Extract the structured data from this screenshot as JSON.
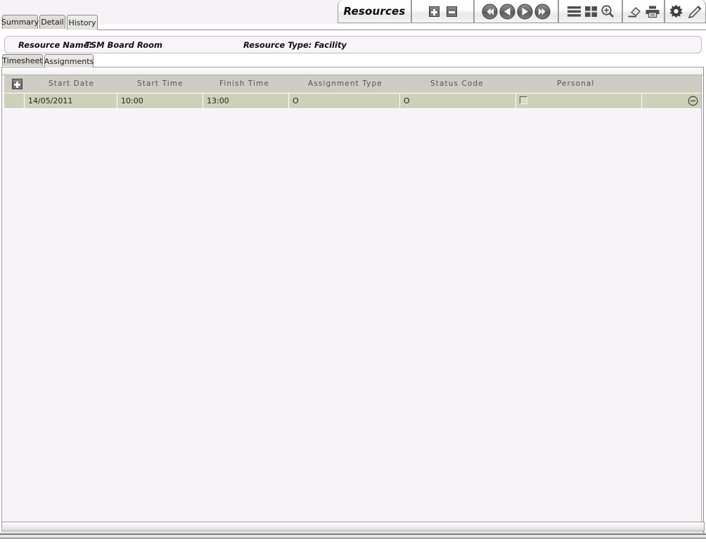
{
  "toolbar": {
    "title": "Resources",
    "groups": [
      {
        "name": "title-group",
        "items": [
          {
            "icon": "resources-label",
            "label": "Resources"
          }
        ]
      },
      {
        "name": "addremove-group",
        "items": [
          {
            "icon": "plus-square-icon",
            "label": "Add"
          },
          {
            "icon": "minus-square-icon",
            "label": "Remove"
          }
        ]
      },
      {
        "name": "navigation-group",
        "items": [
          {
            "icon": "first-record-icon",
            "label": "First"
          },
          {
            "icon": "previous-record-icon",
            "label": "Previous"
          },
          {
            "icon": "next-record-icon",
            "label": "Next"
          },
          {
            "icon": "last-record-icon",
            "label": "Last"
          }
        ]
      },
      {
        "name": "view-group",
        "items": [
          {
            "icon": "list-view-icon",
            "label": "List View"
          },
          {
            "icon": "grid-view-icon",
            "label": "Grid View"
          },
          {
            "icon": "zoom-search-icon",
            "label": "Find"
          }
        ]
      },
      {
        "name": "tools-group",
        "items": [
          {
            "icon": "eraser-icon",
            "label": "Clear"
          },
          {
            "icon": "printer-icon",
            "label": "Print"
          }
        ]
      },
      {
        "name": "edit-group",
        "items": [
          {
            "icon": "gear-icon",
            "label": "Settings"
          },
          {
            "icon": "pencil-icon",
            "label": "Edit"
          }
        ]
      }
    ]
  },
  "main_tabs": [
    {
      "label": "Summary",
      "active": false
    },
    {
      "label": "Detail",
      "active": false
    },
    {
      "label": "History",
      "active": true
    }
  ],
  "info_bar": {
    "resource_name_label": "Resource Name:",
    "resource_name_value": "TSM Board Room",
    "resource_type_label": "Resource Type:",
    "resource_type_value": "Facility"
  },
  "sub_tabs": [
    {
      "label": "Timesheet",
      "active": false
    },
    {
      "label": "Assignments",
      "active": true
    }
  ],
  "grid": {
    "expand_icon": "plus-square-icon",
    "columns": [
      "Start Date",
      "Start Time",
      "Finish Time",
      "Assignment Type",
      "Status Code",
      "Personal"
    ],
    "rows": [
      {
        "start_date": "14/05/2011",
        "start_time": "10:00",
        "finish_time": "13:00",
        "assignment_type": "O",
        "status_code": "O",
        "personal_checked": false,
        "remove_icon": "circle-minus-icon"
      }
    ]
  },
  "colors": {
    "page_background": "#f7f2f7",
    "grid_header": "#cfccc4",
    "row_background": "#ccd2b8",
    "tab_active": "#efeeeb",
    "tab_inactive": "#d7d4ce",
    "panel_background": "#f8f3f8"
  }
}
